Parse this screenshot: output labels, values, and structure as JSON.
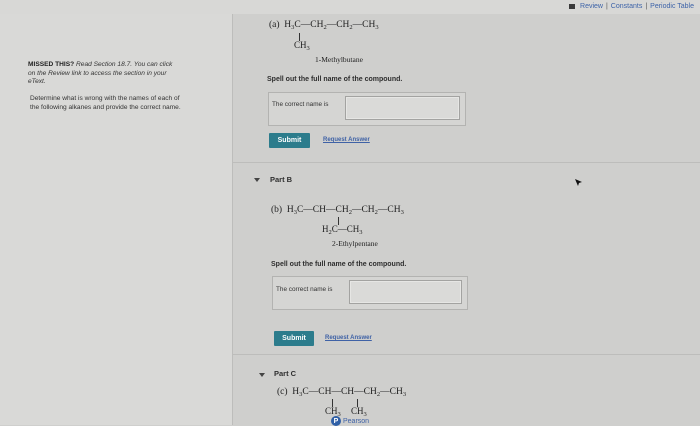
{
  "toplinks": {
    "review": "Review",
    "constants": "Constants",
    "periodic_table": "Periodic Table",
    "separator": "|"
  },
  "left": {
    "missed_title": "MISSED THIS?",
    "missed_text_1": "Read Section 18.7. You can click",
    "missed_text_2": "on the Review link to access the section in your",
    "missed_text_3": "eText.",
    "determine_1": "Determine what is wrong with the names of each of",
    "determine_2": "the following alkanes and provide the correct name."
  },
  "partA": {
    "label": "(a)",
    "chain": [
      "H",
      "C—CH",
      "—CH",
      "—CH"
    ],
    "branch": "CH",
    "caption": "1-Methylbutane",
    "prompt": "Spell out the full name of the compound.",
    "answer_label": "The correct name is",
    "answer_value": "",
    "submit": "Submit",
    "request": "Request Answer"
  },
  "partB": {
    "header": "Part B",
    "label": "(b)",
    "branch": "H",
    "caption": "2-Ethylpentane",
    "prompt": "Spell out the full name of the compound.",
    "answer_label": "The correct name is",
    "answer_value": "",
    "submit": "Submit",
    "request": "Request Answer"
  },
  "partC": {
    "header": "Part C",
    "label": "(c)"
  },
  "footer": {
    "pearson": "Pearson"
  }
}
